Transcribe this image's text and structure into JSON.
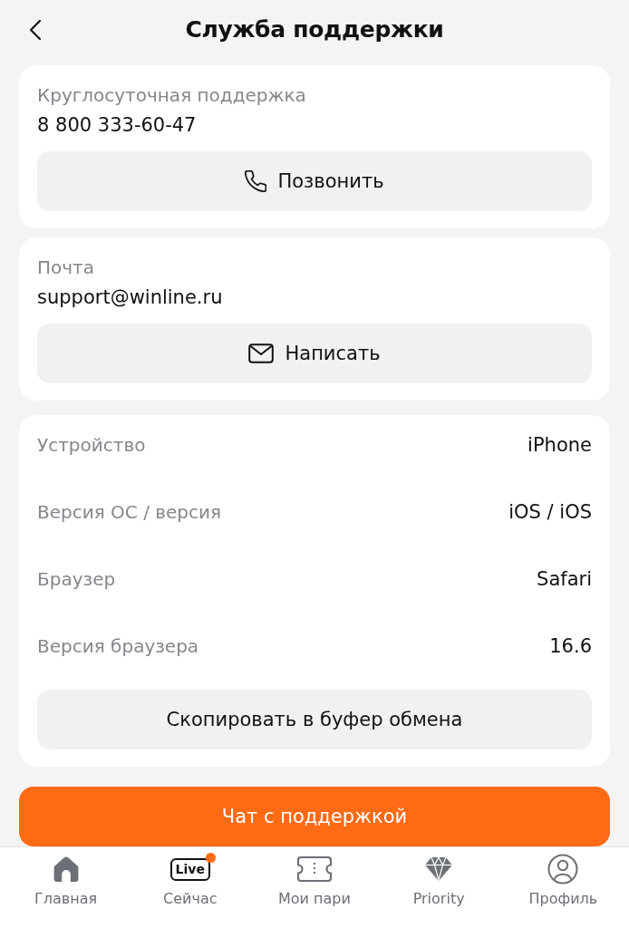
{
  "header": {
    "title": "Служба поддержки"
  },
  "contact_cards": [
    {
      "kind": "phone",
      "label": "Круглосуточная поддержка",
      "value": "8 800 333-60-47",
      "button": "Позвонить"
    },
    {
      "kind": "mail",
      "label": "Почта",
      "value": "support@winline.ru",
      "button": "Написать"
    }
  ],
  "device_info": {
    "rows": [
      {
        "label": "Устройство",
        "value": "iPhone"
      },
      {
        "label": "Версия ОС / версия",
        "value": "iOS / iOS"
      },
      {
        "label": "Браузер",
        "value": "Safari"
      },
      {
        "label": "Версия браузера",
        "value": "16.6"
      }
    ],
    "button": "Скопировать в буфер обмена"
  },
  "chat_button": "Чат с поддержкой",
  "tab_bar": {
    "items": [
      {
        "label": "Главная",
        "notification": false
      },
      {
        "label": "Сейчас",
        "icon_text": "Live",
        "notification": true
      },
      {
        "label": "Мои пари",
        "notification": false
      },
      {
        "label": "Priority",
        "notification": false
      },
      {
        "label": "Профиль",
        "notification": false
      }
    ]
  }
}
